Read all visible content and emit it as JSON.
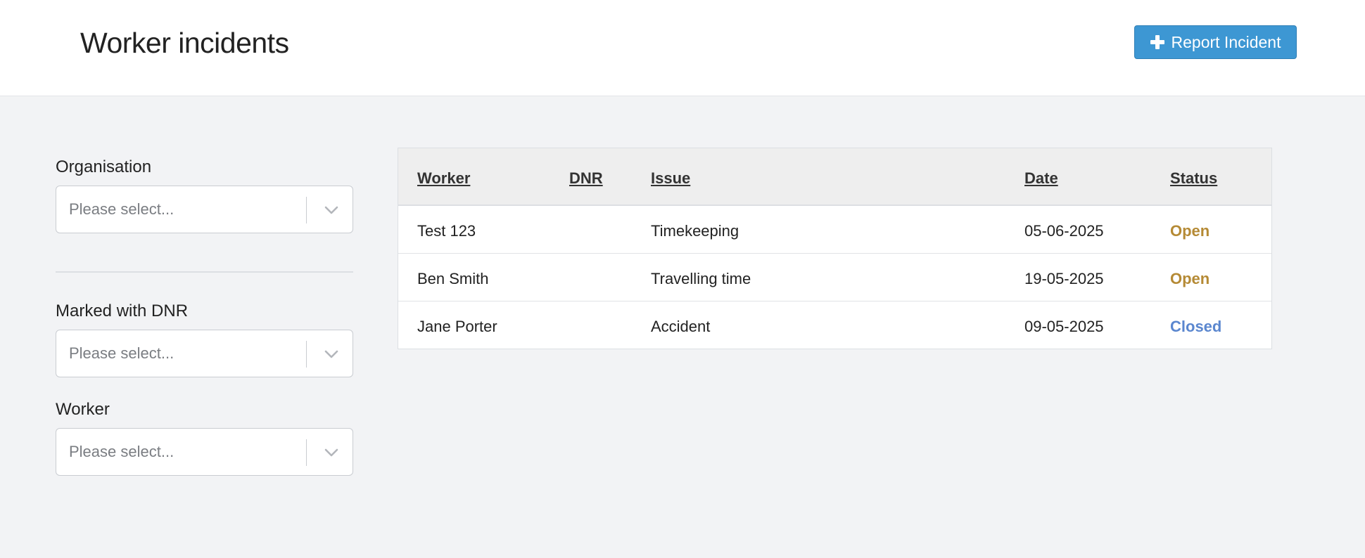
{
  "header": {
    "title": "Worker incidents",
    "report_button_label": "Report Incident"
  },
  "filters": {
    "organisation": {
      "label": "Organisation",
      "placeholder": "Please select..."
    },
    "dnr": {
      "label": "Marked with DNR",
      "placeholder": "Please select..."
    },
    "worker": {
      "label": "Worker",
      "placeholder": "Please select..."
    }
  },
  "table": {
    "columns": [
      "Worker",
      "DNR",
      "Issue",
      "Date",
      "Status"
    ],
    "rows": [
      {
        "worker": "Test 123",
        "dnr": "",
        "issue": "Timekeeping",
        "date": "05-06-2025",
        "status": "Open"
      },
      {
        "worker": "Ben Smith",
        "dnr": "",
        "issue": "Travelling time",
        "date": "19-05-2025",
        "status": "Open"
      },
      {
        "worker": "Jane Porter",
        "dnr": "",
        "issue": "Accident",
        "date": "09-05-2025",
        "status": "Closed"
      }
    ]
  },
  "colors": {
    "accent": "#3d97d3",
    "status_open": "#b58a35",
    "status_closed": "#5b87cf"
  }
}
